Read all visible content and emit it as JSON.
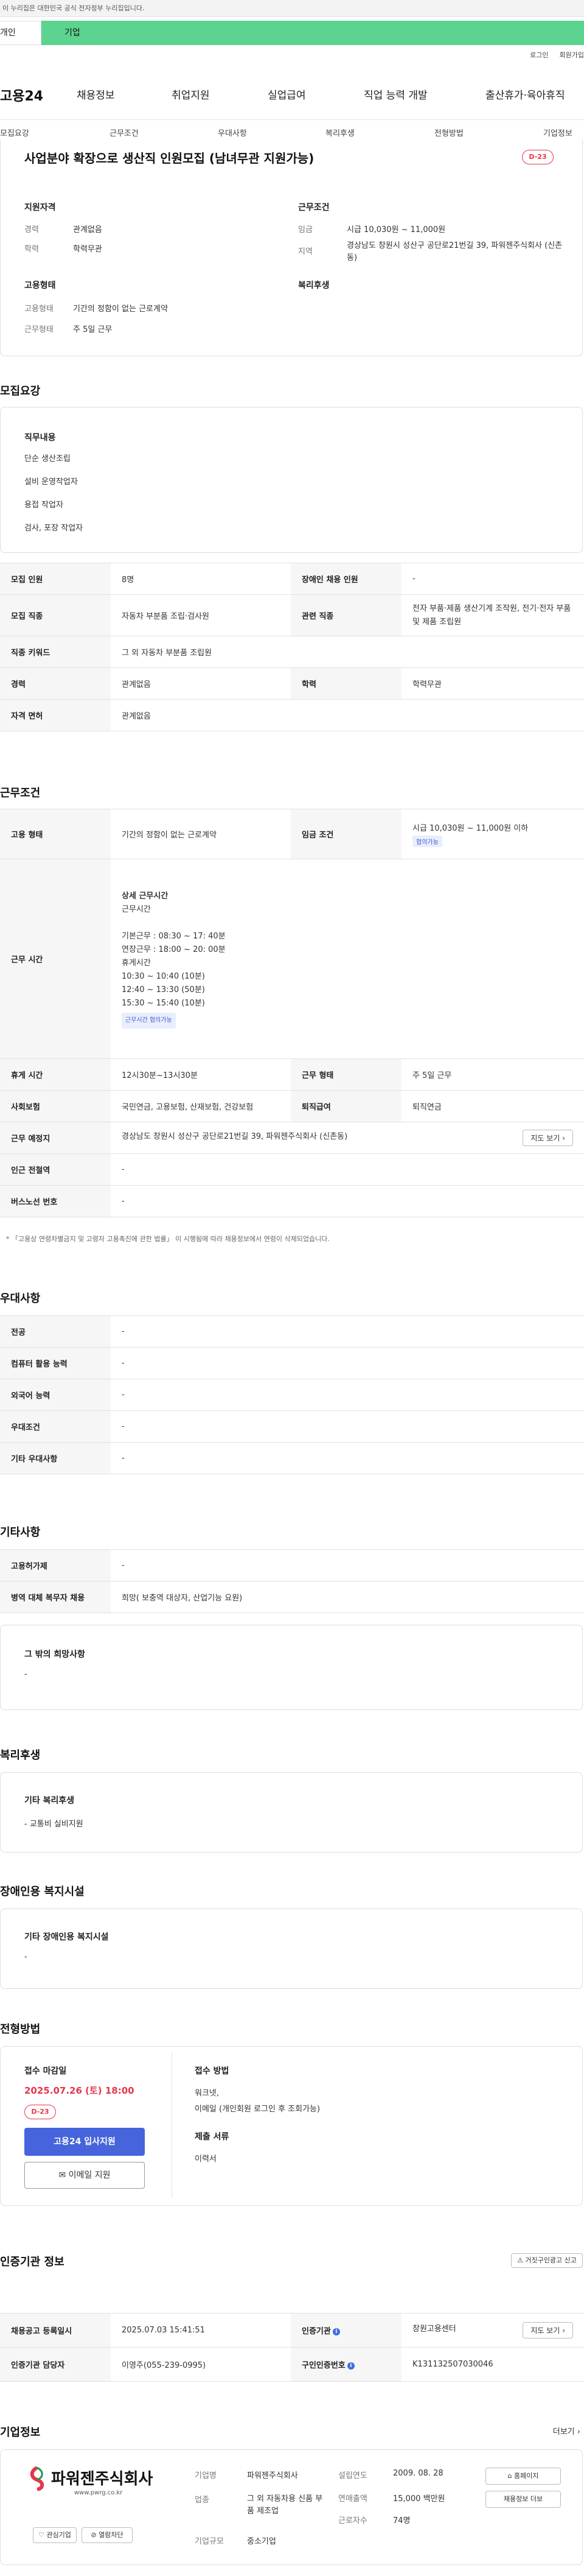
{
  "gov_notice": "이 누리집은 대한민국 공식 전자정부 누리집입니다.",
  "user_types": [
    "개인",
    "기업"
  ],
  "top_links": [
    "로그인",
    "회원가입"
  ],
  "logo": "고용24",
  "gnb": [
    "채용정보",
    "취업지원",
    "실업급여",
    "직업 능력 개발",
    "출산휴가·육아휴직"
  ],
  "sub_nav": [
    "모집요강",
    "근무조건",
    "우대사항",
    "복리후생",
    "전형방법",
    "기업정보"
  ],
  "job": {
    "title": "사업분야 확장으로 생산직 인원모집 (남녀무관 지원가능)",
    "dday": "D-23",
    "qual_heading": "지원자격",
    "qual": [
      {
        "label": "경력",
        "value": "관계없음"
      },
      {
        "label": "학력",
        "value": "학력무관"
      }
    ],
    "cond_heading": "근무조건",
    "cond": [
      {
        "label": "임금",
        "value": "시급 10,030원 ~ 11,000원"
      },
      {
        "label": "지역",
        "value": "경상남도 창원시 성산구 공단로21번길 39, 파워젠주식회사 (신촌동)"
      }
    ],
    "emp_heading": "고용형태",
    "emp": [
      {
        "label": "고용형태",
        "value": "기간의 정함이 없는 근로계약"
      },
      {
        "label": "근무형태",
        "value": "주 5일 근무"
      }
    ],
    "welfare_heading": "복리후생"
  },
  "recruit": {
    "section_title": "모집요강",
    "duties_heading": "직무내용",
    "duties": [
      "단순 생산조립",
      "설비 운영작업자",
      "용접 작업자",
      "검사, 포장 작업자"
    ],
    "rows": [
      {
        "label": "모집 인원",
        "value": "8명",
        "label2": "장애인 채용 인원",
        "value2": "-"
      },
      {
        "label": "모집 직종",
        "value": "자동차 부분품 조립·검사원",
        "label2": "관련 직종",
        "value2": "전자 부품·제품 생산기계 조작원, 전기·전자 부품 및 제품 조립원"
      },
      {
        "label": "직종 키워드",
        "value": "그 외 자동차 부분품 조립원"
      },
      {
        "label": "경력",
        "value": "관계없음",
        "label2": "학력",
        "value2": "학력무관"
      },
      {
        "label": "자격 면허",
        "value": "관계없음"
      }
    ]
  },
  "work": {
    "section_title": "근무조건",
    "emp_type_label": "고용 형태",
    "emp_type": "기간의 정함이 없는 근로계약",
    "wage_label": "임금 조건",
    "wage": "시급 10,030원 ~ 11,000원 이하",
    "wage_chip": "협의가능",
    "hours_label": "근무 시간",
    "hours_title": "상세 근무시간",
    "hours_lines": [
      "근무시간",
      "",
      "기본근무 : 08:30 ~ 17: 40분",
      "연장근무 : 18:00 ~ 20: 00분",
      "휴게시간",
      "10:30 ~ 10:40 (10분)",
      "12:40 ~ 13:30 (50분)",
      "15:30 ~ 15:40 (10분)"
    ],
    "hours_chip": "근무시간 협의가능",
    "break_label": "휴게 시간",
    "break": "12시30분~13시30분",
    "form_label": "근무 형태",
    "form": "주 5일 근무",
    "insurance_label": "사회보험",
    "insurance": "국민연금, 고용보험, 산재보험, 건강보험",
    "retire_label": "퇴직급여",
    "retire": "퇴직연금",
    "place_label": "근무 예정지",
    "place": "경상남도 창원시 성산구 공단로21번길 39, 파워젠주식회사 (신촌동)",
    "map_btn": "지도 보기",
    "station_label": "인근 전철역",
    "station": "-",
    "bus_label": "버스노선 번호",
    "bus": "-",
    "note": "* 「고용상 연령차별금지 및 고령자 고용촉진에 관한 법률」 이 시행됨에 따라 채용정보에서 연령이 삭제되었습니다."
  },
  "pref": {
    "section_title": "우대사항",
    "rows": [
      {
        "label": "전공",
        "value": "-"
      },
      {
        "label": "컴퓨터 활용 능력",
        "value": "-"
      },
      {
        "label": "외국어 능력",
        "value": "-"
      },
      {
        "label": "우대조건",
        "value": "-"
      },
      {
        "label": "기타 우대사항",
        "value": "-"
      }
    ]
  },
  "etc": {
    "section_title": "기타사항",
    "rows": [
      {
        "label": "고용허가제",
        "value": "-"
      },
      {
        "label": "병역 대체 복무자 채용",
        "value": "희망( 보충역 대상자, 산업기능 요원)"
      }
    ],
    "wish_heading": "그 밖의 희망사항",
    "wish": "-"
  },
  "welfare": {
    "section_title": "복리후생",
    "heading": "기타 복리후생",
    "items": [
      "- 교통비 실비지원"
    ]
  },
  "disability": {
    "section_title": "장애인용 복지시설",
    "heading": "기타 장애인용 복지시설",
    "value": "-"
  },
  "selection": {
    "section_title": "전형방법",
    "deadline_label": "접수 마감일",
    "deadline": "2025.07.26 (토) 18:00",
    "dday": "D-23",
    "apply_btn": "고용24 입사지원",
    "email_btn": "이메일 지원",
    "method_label": "접수 방법",
    "method": [
      "워크넷,",
      "이메일 (개인회원 로그인 후 조회가능)"
    ],
    "docs_label": "제출 서류",
    "docs": "이력서"
  },
  "agency": {
    "section_title": "인증기관 정보",
    "report_btn": "거짓구인광고 신고",
    "rows": [
      {
        "label": "채용공고 등록일시",
        "value": "2025.07.03 15:41:51",
        "label2": "인증기관",
        "value2": "창원고용센터",
        "btn": "지도 보기"
      },
      {
        "label": "인증기관 담당자",
        "value": "이영주(055-239-0995)",
        "label2": "구인인증번호",
        "value2": "K131132507030046"
      }
    ]
  },
  "company": {
    "section_title": "기업정보",
    "more": "더보기",
    "logo_text": "파워젠주식회사",
    "logo_url": "www.pwrg.co.kr",
    "interest_btn": "관심기업",
    "block_btn": "열람차단",
    "fields": [
      {
        "label": "기업명",
        "value": "파워젠주식회사"
      },
      {
        "label": "업종",
        "value": "그 외 자동차용 신품 부품 제조업"
      },
      {
        "label": "기업규모",
        "value": "중소기업"
      }
    ],
    "fields2": [
      {
        "label": "설립연도",
        "value": "2009. 08. 28"
      },
      {
        "label": "연매출액",
        "value": "15,000 백만원"
      },
      {
        "label": "근로자수",
        "value": "74명"
      }
    ],
    "homepage_btn": "홈페이지",
    "jobs_btn": "채용정보 더보"
  },
  "colors": {
    "accent": "#4664dc",
    "brand_green": "#5cd38f",
    "dday_red": "#e5374b"
  }
}
